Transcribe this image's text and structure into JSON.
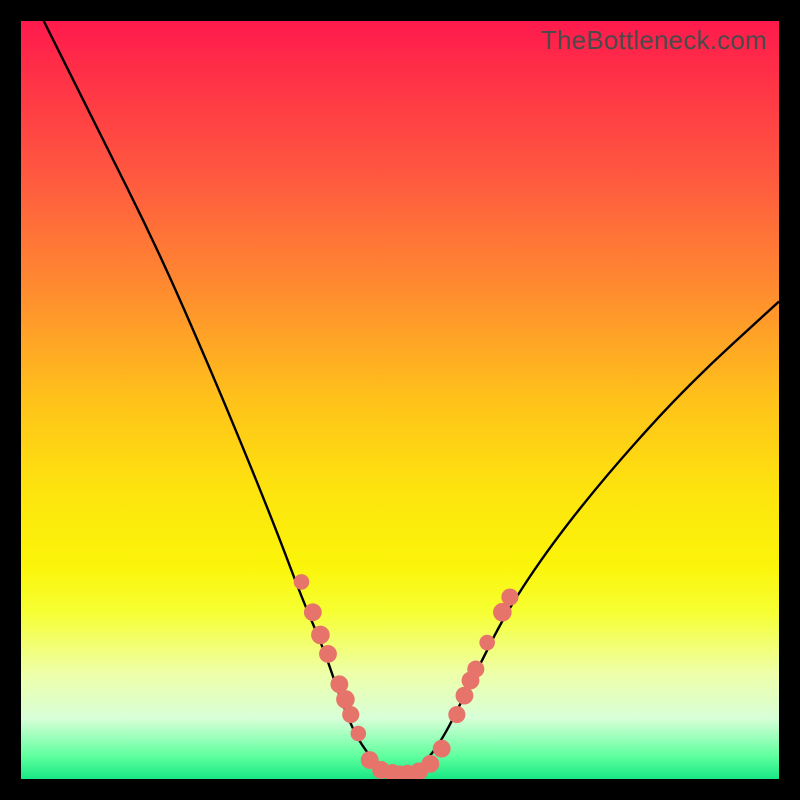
{
  "watermark": "TheBottleneck.com",
  "chart_data": {
    "type": "line",
    "title": "",
    "xlabel": "",
    "ylabel": "",
    "xlim": [
      0,
      100
    ],
    "ylim": [
      0,
      100
    ],
    "series": [
      {
        "name": "bottleneck-curve",
        "x": [
          3,
          10,
          18,
          25,
          30,
          34,
          37,
          40,
          42,
          44,
          46,
          48,
          50,
          52,
          54,
          56,
          58,
          60,
          64,
          70,
          78,
          88,
          100
        ],
        "y": [
          100,
          86,
          70,
          54,
          42,
          32,
          24,
          17,
          11,
          6,
          3,
          1,
          0.5,
          1,
          3,
          6,
          10,
          14,
          22,
          31,
          41,
          52,
          63
        ]
      }
    ],
    "markers": {
      "name": "highlight-dots",
      "color": "#e7746b",
      "points": [
        {
          "x": 37.0,
          "y": 26.0,
          "r": 1.0
        },
        {
          "x": 38.5,
          "y": 22.0,
          "r": 1.3
        },
        {
          "x": 39.5,
          "y": 19.0,
          "r": 1.4
        },
        {
          "x": 40.5,
          "y": 16.5,
          "r": 1.3
        },
        {
          "x": 42.0,
          "y": 12.5,
          "r": 1.3
        },
        {
          "x": 42.8,
          "y": 10.5,
          "r": 1.4
        },
        {
          "x": 43.5,
          "y": 8.5,
          "r": 1.2
        },
        {
          "x": 44.5,
          "y": 6.0,
          "r": 1.0
        },
        {
          "x": 46.0,
          "y": 2.5,
          "r": 1.3
        },
        {
          "x": 47.5,
          "y": 1.2,
          "r": 1.3
        },
        {
          "x": 49.0,
          "y": 0.8,
          "r": 1.3
        },
        {
          "x": 50.0,
          "y": 0.6,
          "r": 1.3
        },
        {
          "x": 51.0,
          "y": 0.7,
          "r": 1.3
        },
        {
          "x": 52.5,
          "y": 1.0,
          "r": 1.3
        },
        {
          "x": 54.0,
          "y": 2.0,
          "r": 1.3
        },
        {
          "x": 55.5,
          "y": 4.0,
          "r": 1.3
        },
        {
          "x": 57.5,
          "y": 8.5,
          "r": 1.2
        },
        {
          "x": 58.5,
          "y": 11.0,
          "r": 1.3
        },
        {
          "x": 59.3,
          "y": 13.0,
          "r": 1.3
        },
        {
          "x": 60.0,
          "y": 14.5,
          "r": 1.2
        },
        {
          "x": 61.5,
          "y": 18.0,
          "r": 1.0
        },
        {
          "x": 63.5,
          "y": 22.0,
          "r": 1.4
        },
        {
          "x": 64.5,
          "y": 24.0,
          "r": 1.2
        }
      ]
    }
  }
}
